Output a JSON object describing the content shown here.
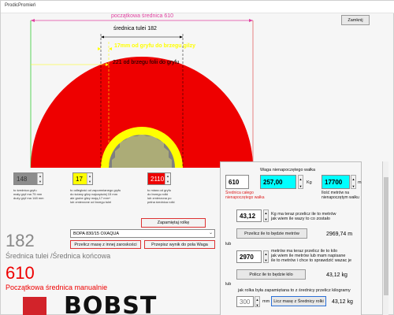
{
  "window": {
    "title": "ProdicPromień"
  },
  "header": {
    "close_label": "Zamknij"
  },
  "diagram": {
    "initial_diameter_label": "początkowa średnica 610",
    "core_diameter_label": "średnica tulei 182",
    "to_glass_label": "17mm od gryfu do brzegu gilzy",
    "to_foil_label": "221 od brzegu folii do gryfu",
    "colors": {
      "roll": "#ee0000",
      "core": "#ffff00",
      "center": "#808080",
      "dim_line": "#e040a0"
    }
  },
  "inputs": {
    "gray": {
      "value": "148",
      "desc": "to średnica gryfu\nmały gryf ma 75 mm\nduży gryf ma 148 mm"
    },
    "yellow": {
      "value": "17",
      "desc": "to odległość od zapomnianego gryfu\ndo ściany gilzy najczęściej 15 mm\nale grube gilzy mają 17 mm+\nlub zmierzone od brzegu tulei"
    },
    "red": {
      "value": "2110",
      "desc": "to miara od gryfu\ndo brzegu rolki\nlub zmierzona po\npełna średnica rolki"
    }
  },
  "save_roll_label": "Zapamiętaj rolkę",
  "left": {
    "core_value": "182",
    "core_label": "Średnica tulei /Średnica końcowa",
    "initial_value": "610",
    "initial_label": "Początkowa średnica manualnie"
  },
  "combo": {
    "selected": "BOPA 830/15 OXAQUA"
  },
  "buttons": {
    "recalc_mass": "Przelicz masę z innej zaroskości",
    "transfer_result": "Przepisz wynik do pola Waga"
  },
  "panel": {
    "weight_title": "Waga nienapoczętego wałka",
    "initial_diam_value": "610",
    "initial_diam_label": "Średnica całego\nnienapoczętego wałka",
    "weight_value": "257,00",
    "weight_unit": "Kg",
    "meters_value": "17700",
    "meters_unit": "m",
    "meters_label": "Ilość metrów na\nnienapoczętym wałku",
    "mass_now_value": "43,12",
    "mass_now_label": "Kg ma teraz przelicz ile to metrów\njak wiem ile wazy to co zostało",
    "calc_meters_btn": "Przelicz ile to będzie metrów",
    "meters_result": "2969,74 m",
    "or1": "lub",
    "meters_now_value": "2970",
    "meters_now_label": "metrów ma teraz przelicz ile to kilo\njak wiem ile metrów lub mam napisane\nile to metrów i chce to sprawdzić wazac je",
    "calc_kg_btn": "Policz ile to będzie kilo",
    "kg_result": "43,12 kg",
    "or2": "lub",
    "remembered_label": "jak rolka była zapamiętana to z średnicy przelicz kilogramy",
    "diam_input_value": "300",
    "diam_input_unit": "mm",
    "calc_from_diam_btn": "Licz masę z Średnicy rolki",
    "final_result": "43,12 kg"
  },
  "logo": {
    "text": "BOBST",
    "color": "#d2232a"
  }
}
